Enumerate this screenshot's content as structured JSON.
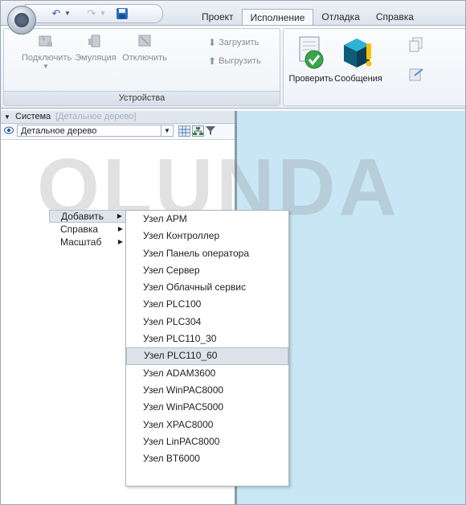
{
  "tabs": [
    {
      "label": "Проект",
      "active": false
    },
    {
      "label": "Исполнение",
      "active": true
    },
    {
      "label": "Отладка",
      "active": false
    },
    {
      "label": "Справка",
      "active": false
    }
  ],
  "ribbon": {
    "devices_group": {
      "label": "Устройства",
      "connect": "Подключить",
      "emulation": "Эмуляция",
      "disconnect": "Отключить",
      "upload": "Загрузить",
      "download": "Выгрузить"
    },
    "check_group": {
      "check": "Проверить",
      "messages": "Сообщения"
    }
  },
  "left_panel": {
    "header_title": "Система",
    "header_hint": "[Детальное дерево]",
    "view_selected": "Детальное дерево"
  },
  "context_menu": {
    "items": [
      {
        "label": "Добавить",
        "highlighted": true
      },
      {
        "label": "Справка",
        "highlighted": false
      },
      {
        "label": "Масштаб",
        "highlighted": false
      }
    ]
  },
  "submenu": {
    "items": [
      "Узел АРМ",
      "Узел Контроллер",
      "Узел Панель оператора",
      "Узел Сервер",
      "Узел Облачный сервис",
      "Узел PLC100",
      "Узел PLC304",
      "Узел PLC110_30",
      "Узел PLC110_60",
      "Узел ADAM3600",
      "Узел WinPAC8000",
      "Узел WinPAC5000",
      "Узел XPAC8000",
      "Узел LinPAC8000",
      "Узел BT6000"
    ],
    "highlighted_index": 8
  },
  "watermark": "OLUNDA",
  "colors": {
    "accent_blue": "#2a5db0",
    "workspace": "#c9e6f5",
    "check_green": "#3aa64a",
    "warning_yellow": "#f5c400"
  }
}
